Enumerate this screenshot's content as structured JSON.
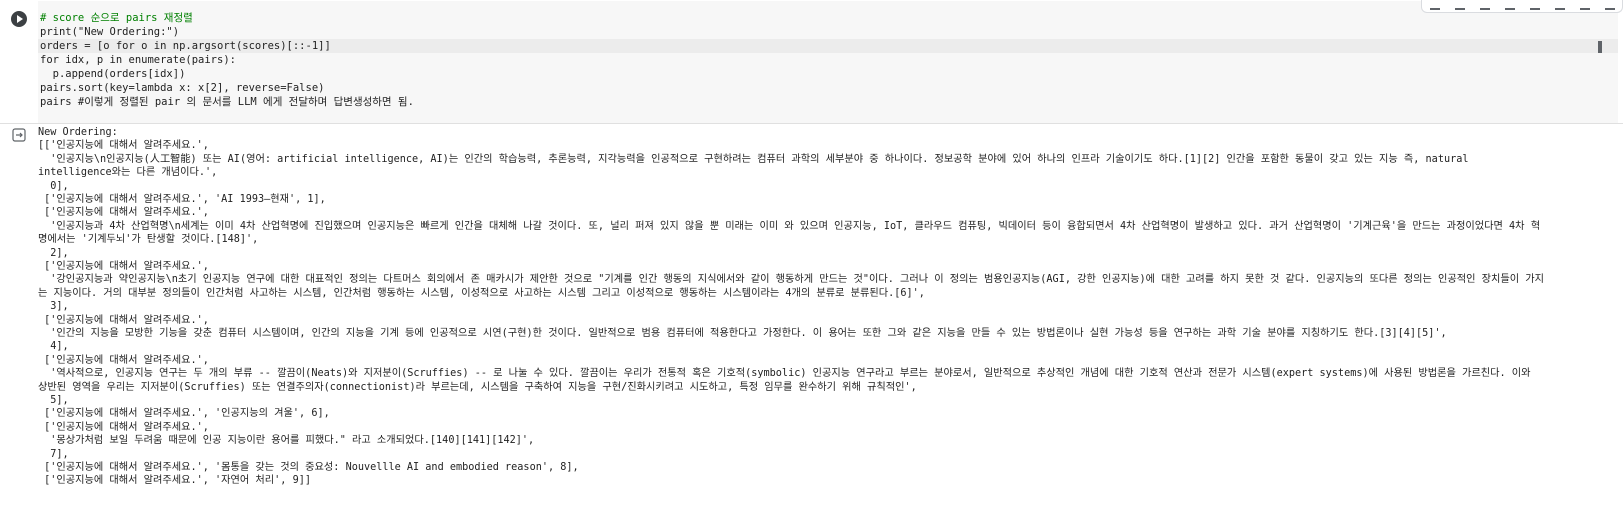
{
  "code": {
    "lines": [
      "# score 순으로 pairs 재정렬",
      "print(\"New Ordering:\")",
      "orders = [o for o in np.argsort(scores)[::-1]]",
      "for idx, p in enumerate(pairs):",
      "  p.append(orders[idx])",
      "pairs.sort(key=lambda x: x[2], reverse=False)",
      "pairs #이렇게 정렬된 pair 의 문서를 LLM 에게 전달하며 답변생성하면 됨."
    ]
  },
  "output": {
    "lines": [
      "New Ordering:",
      "[['인공지능에 대해서 알려주세요.',",
      "  '인공지능\\n인공지능(人工智能) 또는 AI(영어: artificial intelligence, AI)는 인간의 학습능력, 추론능력, 지각능력을 인공적으로 구현하려는 컴퓨터 과학의 세부분야 중 하나이다. 정보공학 분야에 있어 하나의 인프라 기술이기도 하다.[1][2] 인간을 포함한 동물이 갖고 있는 지능 즉, natural",
      "intelligence와는 다른 개념이다.',",
      "  0],",
      " ['인공지능에 대해서 알려주세요.', 'AI 1993–현재', 1],",
      " ['인공지능에 대해서 알려주세요.',",
      "  '인공지능과 4차 산업혁명\\n세계는 이미 4차 산업혁명에 진입했으며 인공지능은 빠르게 인간을 대체해 나갈 것이다. 또, 널리 퍼져 있지 않을 뿐 미래는 이미 와 있으며 인공지능, IoT, 클라우드 컴퓨팅, 빅데이터 등이 융합되면서 4차 산업혁명이 발생하고 있다. 과거 산업혁명이 '기계근육'을 만드는 과정이었다면 4차 혁",
      "명에서는 '기계두뇌'가 탄생할 것이다.[148]',",
      "  2],",
      " ['인공지능에 대해서 알려주세요.',",
      "  '강인공지능과 약인공지능\\n초기 인공지능 연구에 대한 대표적인 정의는 다트머스 회의에서 존 매카시가 제안한 것으로 \"기계를 인간 행동의 지식에서와 같이 행동하게 만드는 것\"이다. 그러나 이 정의는 범용인공지능(AGI, 강한 인공지능)에 대한 고려를 하지 못한 것 같다. 인공지능의 또다른 정의는 인공적인 장치들이 가지",
      "는 지능이다. 거의 대부분 정의들이 인간처럼 사고하는 시스템, 인간처럼 행동하는 시스템, 이성적으로 사고하는 시스템 그리고 이성적으로 행동하는 시스템이라는 4개의 분류로 분류된다.[6]',",
      "  3],",
      " ['인공지능에 대해서 알려주세요.',",
      "  '인간의 지능을 모방한 기능을 갖춘 컴퓨터 시스템이며, 인간의 지능을 기계 등에 인공적으로 시연(구현)한 것이다. 일반적으로 범용 컴퓨터에 적용한다고 가정한다. 이 용어는 또한 그와 같은 지능을 만들 수 있는 방법론이나 실현 가능성 등을 연구하는 과학 기술 분야를 지칭하기도 한다.[3][4][5]',",
      "  4],",
      " ['인공지능에 대해서 알려주세요.',",
      "  '역사적으로, 인공지능 연구는 두 개의 부류 -- 깔끔이(Neats)와 지저분이(Scruffies) -- 로 나눌 수 있다. 깔끔이는 우리가 전통적 혹은 기호적(symbolic) 인공지능 연구라고 부르는 분야로서, 일반적으로 추상적인 개념에 대한 기호적 연산과 전문가 시스템(expert systems)에 사용된 방법론을 가르친다. 이와",
      "상반된 영역을 우리는 지저분이(Scruffies) 또는 연결주의자(connectionist)라 부르는데, 시스템을 구축하여 지능을 구현/진화시키려고 시도하고, 특정 임무를 완수하기 위해 규칙적인',",
      "  5],",
      " ['인공지능에 대해서 알려주세요.', '인공지능의 겨울', 6],",
      " ['인공지능에 대해서 알려주세요.',",
      "  '몽상가처럼 보일 두려움 때문에 인공 지능이란 용어를 피했다.\" 라고 소개되었다.[140][141][142]',",
      "  7],",
      " ['인공지능에 대해서 알려주세요.', '몸통을 갖는 것의 중요성: Nouvellle AI and embodied reason', 8],",
      " ['인공지능에 대해서 알려주세요.', '자연어 처리', 9]]"
    ]
  }
}
